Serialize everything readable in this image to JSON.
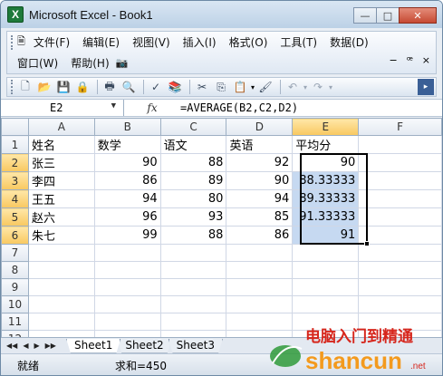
{
  "window": {
    "title": "Microsoft Excel - Book1",
    "minimize": "—",
    "restore": "□",
    "close": "✕"
  },
  "menu": {
    "items": [
      "文件(F)",
      "编辑(E)",
      "视图(V)",
      "插入(I)",
      "格式(O)",
      "工具(T)",
      "数据(D)"
    ],
    "items_row2": [
      "窗口(W)",
      "帮助(H)"
    ],
    "doc_controls": [
      "−",
      "ꟹ",
      "×"
    ]
  },
  "toolbar": {
    "icons": [
      "new-icon",
      "open-icon",
      "save-icon",
      "permission-icon",
      "print-icon",
      "print-preview-icon",
      "spelling-icon",
      "research-icon",
      "cut-icon",
      "copy-icon",
      "paste-icon",
      "format-painter-icon",
      "undo-icon",
      "redo-icon"
    ],
    "glyphs": [
      "🗋",
      "📂",
      "💾",
      "🔒",
      "🖶",
      "🔍",
      "✓",
      "📚",
      "✂",
      "⎘",
      "📋",
      "🖌",
      "↶",
      "↷"
    ]
  },
  "formula_bar": {
    "name_box": "E2",
    "fx": "fx",
    "formula": "=AVERAGE(B2,C2,D2)"
  },
  "sheet": {
    "columns": [
      "A",
      "B",
      "C",
      "D",
      "E",
      "F"
    ],
    "row_numbers": [
      "1",
      "2",
      "3",
      "4",
      "5",
      "6",
      "7",
      "8",
      "9",
      "10",
      "11",
      "12"
    ],
    "rows": [
      [
        "姓名",
        "数学",
        "语文",
        "英语",
        "平均分",
        ""
      ],
      [
        "张三",
        "90",
        "88",
        "92",
        "90",
        ""
      ],
      [
        "李四",
        "86",
        "89",
        "90",
        "88.33333",
        ""
      ],
      [
        "王五",
        "94",
        "80",
        "94",
        "89.33333",
        ""
      ],
      [
        "赵六",
        "96",
        "93",
        "85",
        "91.33333",
        ""
      ],
      [
        "朱七",
        "99",
        "88",
        "86",
        "91",
        ""
      ],
      [
        "",
        "",
        "",
        "",
        "",
        ""
      ],
      [
        "",
        "",
        "",
        "",
        "",
        ""
      ],
      [
        "",
        "",
        "",
        "",
        "",
        ""
      ],
      [
        "",
        "",
        "",
        "",
        "",
        ""
      ],
      [
        "",
        "",
        "",
        "",
        "",
        ""
      ],
      [
        "",
        "",
        "",
        "",
        "",
        ""
      ]
    ]
  },
  "tabs": {
    "nav": [
      "◀◀",
      "◀",
      "▶",
      "▶▶"
    ],
    "sheets": [
      "Sheet1",
      "Sheet2",
      "Sheet3"
    ]
  },
  "status": {
    "mode": "就绪",
    "sum": "求和=450"
  },
  "watermark": {
    "text_cn": "电脑入门到精通",
    "text_en": "shancun",
    "domain": ".net"
  },
  "colors": {
    "selection": "#c6d9f1",
    "active_header": "#f8c860",
    "watermark_green": "#2f9a3a",
    "watermark_orange": "#f39a1e",
    "watermark_red": "#d6261c"
  }
}
